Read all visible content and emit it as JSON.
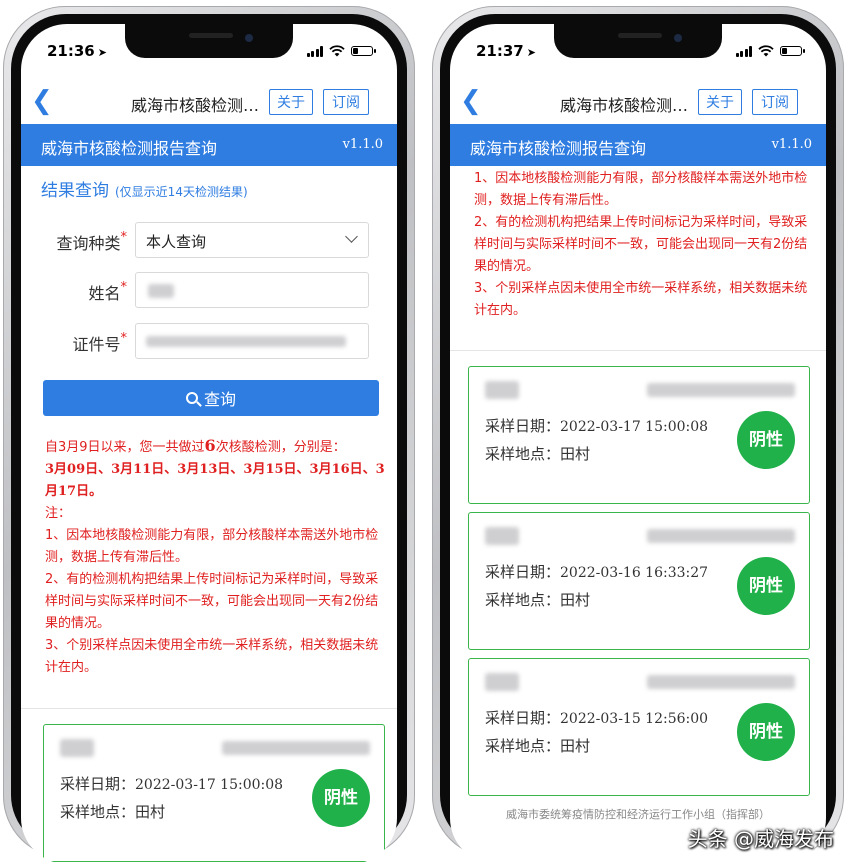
{
  "status": {
    "left_time": "21:36",
    "right_time": "21:37"
  },
  "nav": {
    "back_icon": "chevron-left-icon",
    "title": "威海市核酸检测…",
    "about_label": "关于",
    "subscribe_label": "订阅"
  },
  "banner": {
    "title": "威海市核酸检测报告查询",
    "version": "v1.1.0"
  },
  "query": {
    "section_title": "结果查询",
    "section_hint": "(仅显示近14天检测结果)",
    "type_label": "查询种类",
    "type_value": "本人查询",
    "name_label": "姓名",
    "id_label": "证件号",
    "required_mark": "*",
    "submit_label": "查询"
  },
  "notice": {
    "summary_prefix": "自3月9日以来，您一共做过",
    "summary_count": "6",
    "summary_suffix": "次核酸检测，分别是：",
    "dates_line": "3月09日、3月11日、3月13日、3月15日、3月16日、3月17日。",
    "note_label": "注：",
    "items": [
      "1、因本地核酸检测能力有限，部分核酸样本需送外地市检测，数据上传有滞后性。",
      "2、有的检测机构把结果上传时间标记为采样时间，导致采样时间与实际采样时间不一致，可能会出现同一天有2份结果的情况。",
      "3、个别采样点因未使用全市统一采样系统，相关数据未统计在内。"
    ]
  },
  "result_labels": {
    "date_label": "采样日期：",
    "place_label": "采样地点："
  },
  "results": [
    {
      "date": "2022-03-17 15:00:08",
      "place": "田村",
      "status": "阴性"
    },
    {
      "date": "2022-03-16 16:33:27",
      "place": "田村",
      "status": "阴性"
    },
    {
      "date": "2022-03-15 12:56:00",
      "place": "田村",
      "status": "阴性"
    }
  ],
  "footer": {
    "text": "威海市委统筹疫情防控和经济运行工作小组（指挥部）"
  },
  "watermark": "头条 @威海发布"
}
